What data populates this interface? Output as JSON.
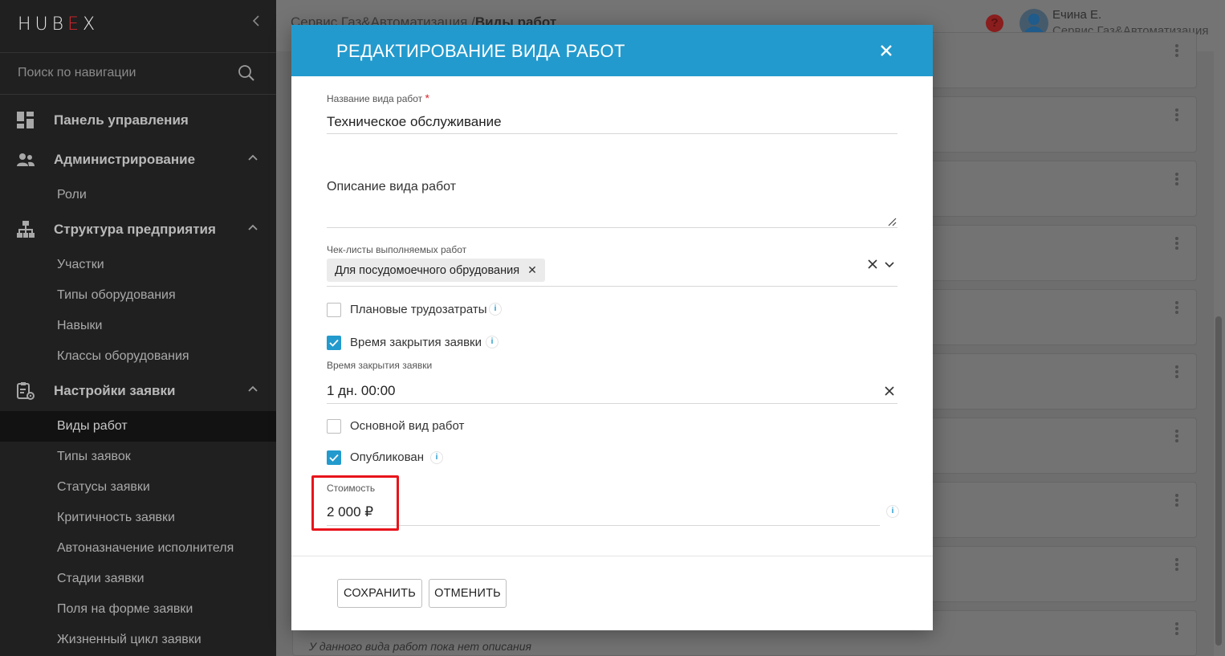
{
  "sidebar": {
    "logo_left": "HUB",
    "logo_mid": "E",
    "logo_right": "X",
    "search_placeholder": "Поиск по навигации",
    "sections": {
      "dashboard": "Панель управления",
      "admin": "Администрирование",
      "structure": "Структура предприятия",
      "settings": "Настройки заявки"
    },
    "admin_items": [
      "Роли"
    ],
    "structure_items": [
      "Участки",
      "Типы оборудования",
      "Навыки",
      "Классы оборудования"
    ],
    "settings_items": [
      "Виды работ",
      "Типы заявок",
      "Статусы заявки",
      "Критичность заявки",
      "Автоназначение исполнителя",
      "Стадии заявки",
      "Поля на форме заявки",
      "Жизненный цикл заявки"
    ]
  },
  "topbar": {
    "breadcrumb_prefix": "Сервис Газ&Автоматизация /",
    "breadcrumb_current": "Виды работ",
    "help_symbol": "?",
    "user_name": "Ечина Е.",
    "user_org": "Сервис Газ&Автоматизация"
  },
  "background": {
    "empty_description": "У данного вида работ пока нет описания"
  },
  "modal": {
    "title": "РЕДАКТИРОВАНИЕ ВИДА РАБОТ",
    "name_label": "Название вида работ",
    "required_mark": "*",
    "name_value": "Техническое обслуживание",
    "description_label": "Описание вида работ",
    "checklists_label": "Чек-листы выполняемых работ",
    "checklist_chip": "Для посудомоечного обрудования",
    "planned_label": "Плановые трудозатраты",
    "planned_checked": false,
    "close_time_label": "Время закрытия заявки",
    "close_time_checked": true,
    "close_time_field_label": "Время закрытия заявки",
    "close_time_value": "1 дн. 00:00",
    "main_type_label": "Основной вид работ",
    "main_type_checked": false,
    "published_label": "Опубликован",
    "published_checked": true,
    "cost_label": "Стоимость",
    "cost_value": "2 000 ₽",
    "save_button": "СОХРАНИТЬ",
    "cancel_button": "ОТМЕНИТЬ",
    "info_symbol": "i"
  },
  "colors": {
    "accent": "#239acd",
    "highlight": "#e8141b",
    "sidebar_bg": "#202020"
  }
}
